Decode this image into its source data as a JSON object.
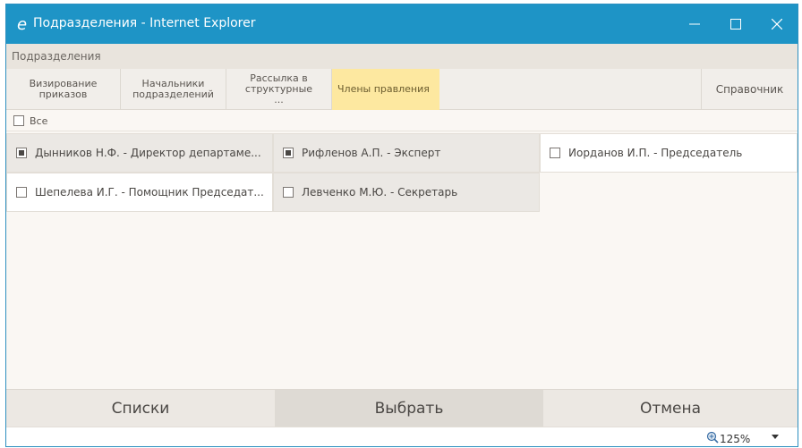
{
  "window": {
    "title": "Подразделения - Internet Explorer"
  },
  "section": {
    "header": "Подразделения"
  },
  "tabs": [
    {
      "label": "Визирование приказов",
      "active": false
    },
    {
      "label": "Начальники подразделений",
      "active": false
    },
    {
      "label": "Рассылка в структурные ...",
      "active": false
    },
    {
      "label": "Члены правления",
      "active": true
    }
  ],
  "reference_tab": "Справочник",
  "select_all": {
    "label": "Все",
    "checked": false
  },
  "members": [
    {
      "label": "Дынников Н.Ф. - Директор департаме...",
      "checked": true
    },
    {
      "label": "Рифленов А.П. - Эксперт",
      "checked": true
    },
    {
      "label": "Иорданов И.П. - Председатель",
      "checked": false
    },
    {
      "label": "Шепелева И.Г. - Помощник Председат...",
      "checked": false
    },
    {
      "label": "Левченко М.Ю. - Секретарь",
      "checked": false
    }
  ],
  "buttons": {
    "lists": "Списки",
    "select": "Выбрать",
    "cancel": "Отмена"
  },
  "status": {
    "zoom": "125%"
  },
  "colors": {
    "titlebar": "#1e94c6",
    "active_tab": "#fde8a0"
  }
}
